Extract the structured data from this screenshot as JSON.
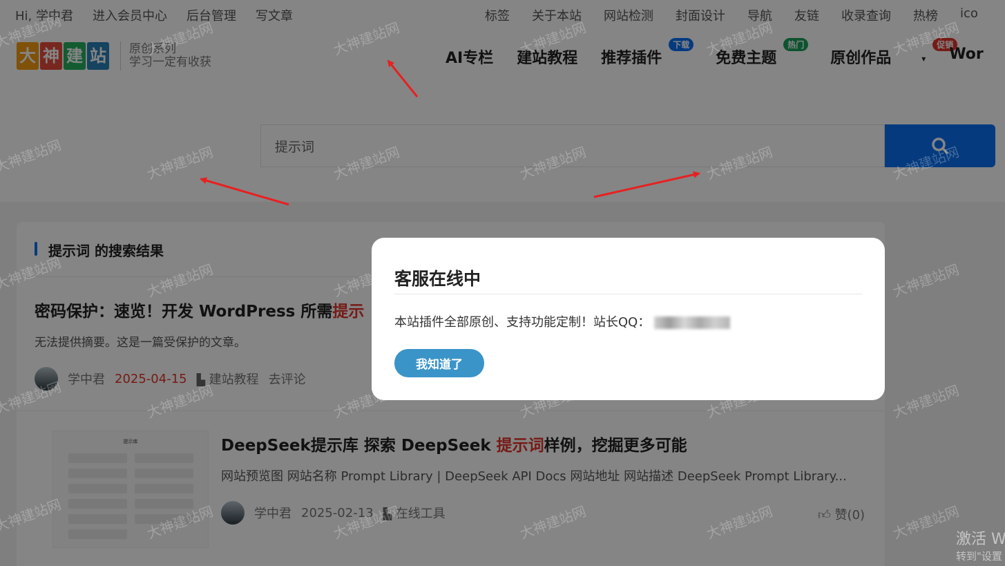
{
  "topbar": {
    "left": [
      "Hi, 学中君",
      "进入会员中心",
      "后台管理",
      "写文章"
    ],
    "right": [
      "标签",
      "关于本站",
      "网站检测",
      "封面设计",
      "导航",
      "友链",
      "收录查询",
      "热榜",
      "ico"
    ]
  },
  "logo": {
    "chars": [
      "大",
      "神",
      "建",
      "站"
    ],
    "colors": [
      "#f39c12",
      "#e74c3c",
      "#27ae60",
      "#2980b9"
    ],
    "sub1": "原创系列",
    "sub2": "学习一定有收获"
  },
  "nav": {
    "items": [
      {
        "label": "AI专栏"
      },
      {
        "label": "建站教程"
      },
      {
        "label": "推荐插件",
        "badge": "下载",
        "badge_color": "#0a6ff2"
      },
      {
        "label": "免费主题",
        "badge": "热门",
        "badge_color": "#18a058"
      },
      {
        "label": "原创作品",
        "badge": "促销",
        "badge_color": "#e0352b",
        "caret": "▾"
      },
      {
        "label": "Wor"
      }
    ]
  },
  "search": {
    "value": "提示词",
    "button_icon": "search-icon"
  },
  "results": {
    "heading_keyword": "提示词",
    "heading_suffix": " 的搜索结果",
    "post1": {
      "title_prefix": "密码保护：速览！开发 WordPress 所需",
      "title_hl": "提示",
      "excerpt": "无法提供摘要。这是一篇受保护的文章。",
      "author": "学中君",
      "date": "2025-04-15",
      "category": "建站教程",
      "comment": "去评论"
    },
    "post2": {
      "title_prefix": "DeepSeek提示库 探索 DeepSeek ",
      "title_hl": "提示词",
      "title_suffix": "样例，挖掘更多可能",
      "excerpt": "网站预览图 网站名称 Prompt Library | DeepSeek API Docs 网站地址 网站描述 DeepSeek Prompt Library...",
      "author": "学中君",
      "date": "2025-02-13",
      "category": "在线工具",
      "like": "赞(0)",
      "thumb_title": "提示库"
    }
  },
  "modal": {
    "title": "客服在线中",
    "text": "本站插件全部原创、支持功能定制！站长QQ：",
    "button": "我知道了"
  },
  "watermark": "大神建站网",
  "activate": {
    "line1": "激活 W",
    "line2": "转到\"设置"
  },
  "colors": {
    "accent": "#0a6ff2",
    "highlight": "#e0352b",
    "modal_button": "#3b94c8",
    "arrow": "#e82020"
  }
}
